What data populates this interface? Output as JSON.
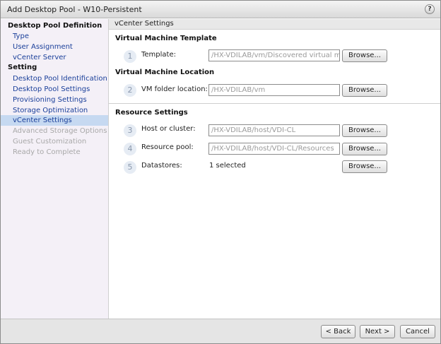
{
  "window": {
    "title": "Add Desktop Pool - W10-Persistent",
    "help_label": "?"
  },
  "sidebar": {
    "sections": [
      {
        "heading": "Desktop Pool Definition",
        "items": [
          {
            "label": "Type",
            "state": "link"
          },
          {
            "label": "User Assignment",
            "state": "link"
          },
          {
            "label": "vCenter Server",
            "state": "link"
          }
        ]
      },
      {
        "heading": "Setting",
        "items": [
          {
            "label": "Desktop Pool Identification",
            "state": "link"
          },
          {
            "label": "Desktop Pool Settings",
            "state": "link"
          },
          {
            "label": "Provisioning Settings",
            "state": "link"
          },
          {
            "label": "Storage Optimization",
            "state": "link"
          },
          {
            "label": "vCenter Settings",
            "state": "selected"
          },
          {
            "label": "Advanced Storage Options",
            "state": "disabled"
          },
          {
            "label": "Guest Customization",
            "state": "disabled"
          },
          {
            "label": "Ready to Complete",
            "state": "disabled"
          }
        ]
      }
    ]
  },
  "main": {
    "header": "vCenter Settings",
    "sections": {
      "vm_template": "Virtual Machine Template",
      "vm_location": "Virtual Machine Location",
      "resource": "Resource Settings"
    },
    "fields": [
      {
        "step": "1",
        "label": "Template:",
        "value": "/HX-VDILAB/vm/Discovered virtual machine",
        "browse": "Browse..."
      },
      {
        "step": "2",
        "label": "VM folder location:",
        "value": "/HX-VDILAB/vm",
        "browse": "Browse..."
      },
      {
        "step": "3",
        "label": "Host or cluster:",
        "value": "/HX-VDILAB/host/VDI-CL",
        "browse": "Browse..."
      },
      {
        "step": "4",
        "label": "Resource pool:",
        "value": "/HX-VDILAB/host/VDI-CL/Resources",
        "browse": "Browse..."
      },
      {
        "step": "5",
        "label": "Datastores:",
        "value": "1 selected",
        "browse": "Browse..."
      }
    ]
  },
  "footer": {
    "back": "< Back",
    "next": "Next >",
    "cancel": "Cancel"
  },
  "colors": {
    "link": "#1a3f9a",
    "disabled": "#a8a8a8",
    "selected_bg": "#c6d9f1",
    "sidebar_bg": "#f4f0f7"
  }
}
